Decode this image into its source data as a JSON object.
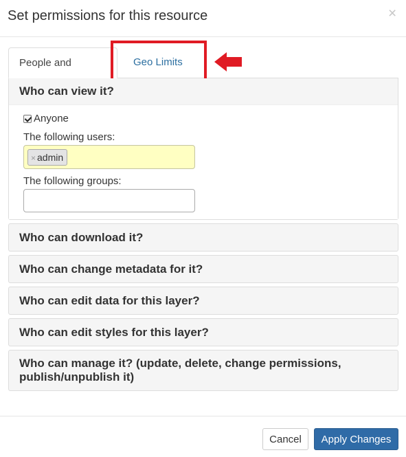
{
  "modal": {
    "title": "Set permissions for this resource",
    "close_label": "×"
  },
  "tabs": [
    {
      "label": "People and Groups",
      "active": true
    },
    {
      "label": "Geo Limits",
      "active": false
    }
  ],
  "panels": {
    "view": {
      "heading": "Who can view it?",
      "anyone_label": "Anyone",
      "anyone_checked": true,
      "users_label": "The following users:",
      "users": [
        "admin"
      ],
      "groups_label": "The following groups:",
      "groups_value": ""
    },
    "download": {
      "heading": "Who can download it?"
    },
    "metadata": {
      "heading": "Who can change metadata for it?"
    },
    "edit_data": {
      "heading": "Who can edit data for this layer?"
    },
    "edit_styles": {
      "heading": "Who can edit styles for this layer?"
    },
    "manage": {
      "heading_line1": "Who can manage it? (update, delete, change permissions,",
      "heading_line2": "publish/unpublish it)"
    }
  },
  "tag_remove_label": "×",
  "footer": {
    "cancel_label": "Cancel",
    "apply_label": "Apply Changes"
  },
  "colors": {
    "highlight": "#e01b24",
    "primary": "#2f6ba7",
    "link": "#2b6ea0",
    "users_field_bg": "#ffffc2"
  }
}
